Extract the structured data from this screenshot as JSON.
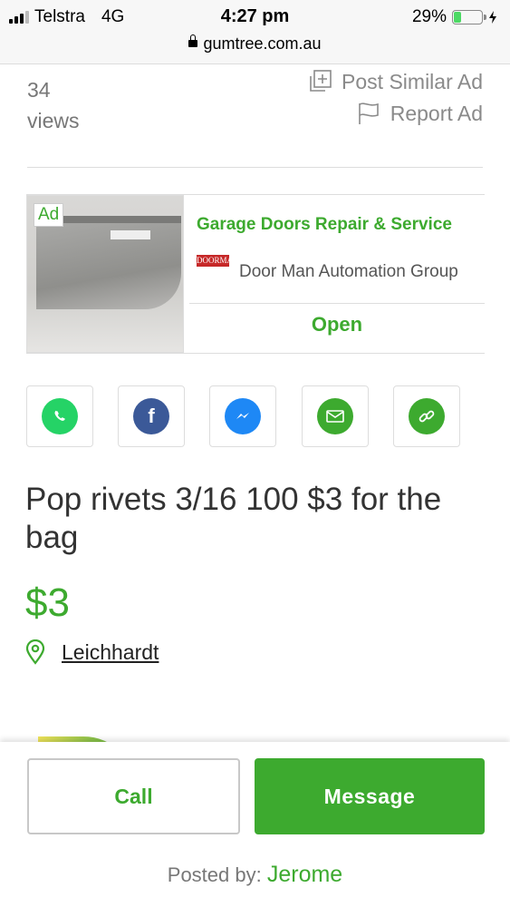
{
  "status_bar": {
    "carrier": "Telstra",
    "network": "4G",
    "time": "4:27 pm",
    "battery_percent_label": "29%",
    "battery_level": 0.29,
    "url": "gumtree.com.au"
  },
  "listing_meta": {
    "views": "34 views",
    "post_similar_label": "Post Similar Ad",
    "report_label": "Report Ad"
  },
  "ad": {
    "badge": "Ad",
    "title": "Garage Doors Repair & Service",
    "logo_text": "DOORMAN",
    "advertiser": "Door Man Automation Group",
    "cta": "Open"
  },
  "share": [
    {
      "icon": "whatsapp-icon",
      "color": "#25d366"
    },
    {
      "icon": "facebook-icon",
      "color": "#3b5998"
    },
    {
      "icon": "messenger-icon",
      "color": "#1e88f5"
    },
    {
      "icon": "email-icon",
      "color": "#3daa2f"
    },
    {
      "icon": "link-icon",
      "color": "#3daa2f"
    }
  ],
  "item": {
    "title": "Pop rivets 3/16 100 $3 for the bag",
    "price": "$3",
    "location": "Leichhardt"
  },
  "actions": {
    "call_label": "Call",
    "message_label": "Message",
    "posted_by_label": "Posted by:",
    "poster_name": "Jerome"
  },
  "colors": {
    "brand_green": "#3daa2f"
  }
}
